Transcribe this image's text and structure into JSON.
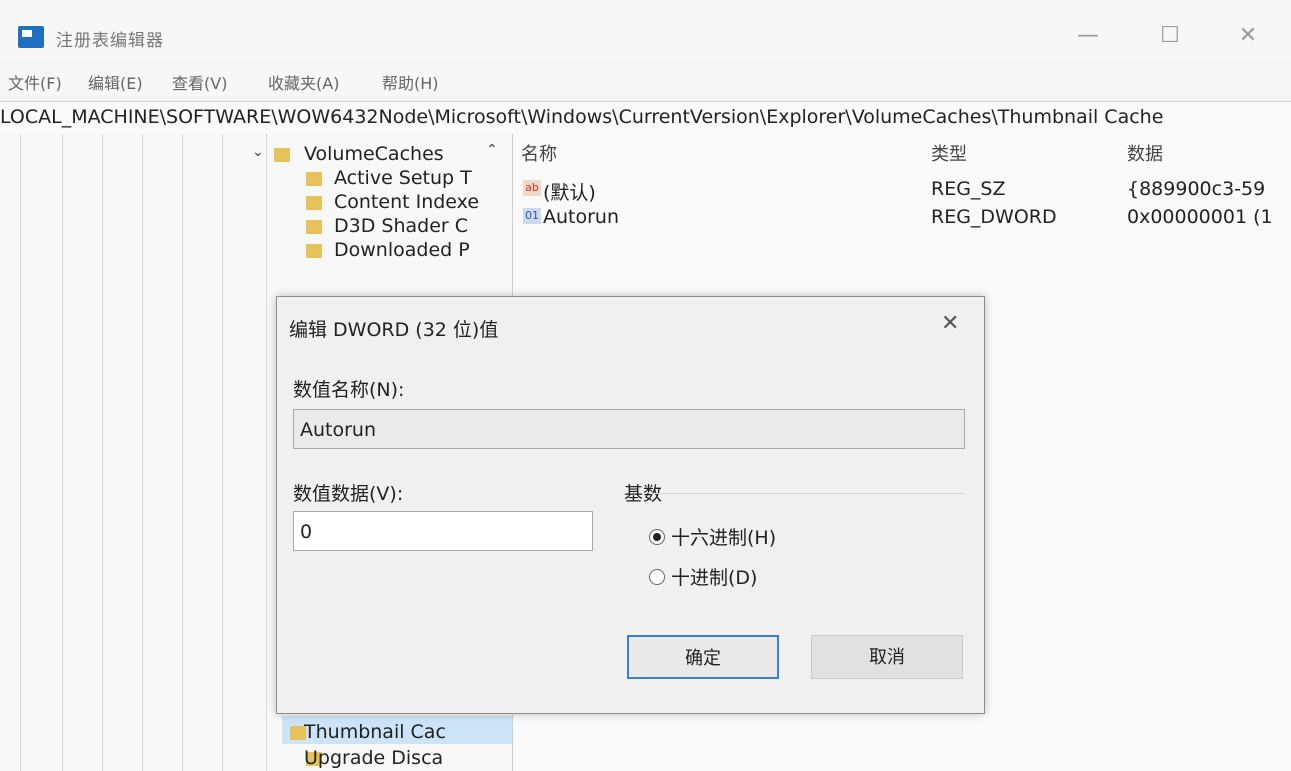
{
  "window": {
    "title": "注册表编辑器",
    "minimize": "—",
    "maximize": "☐",
    "close": "✕"
  },
  "menu": [
    "文件(F)",
    "编辑(E)",
    "查看(V)",
    "收藏夹(A)",
    "帮助(H)"
  ],
  "address": "LOCAL_MACHINE\\SOFTWARE\\WOW6432Node\\Microsoft\\Windows\\CurrentVersion\\Explorer\\VolumeCaches\\Thumbnail Cache",
  "tree": {
    "parent": "VolumeCaches",
    "items": [
      "Active Setup T",
      "Content Indexe",
      "D3D Shader C",
      "Downloaded P"
    ],
    "bottom_items": [
      "Thumbnail Cac",
      "Upgrade Disca"
    ]
  },
  "list": {
    "headers": [
      "名称",
      "类型",
      "数据"
    ],
    "rows": [
      {
        "name": "(默认)",
        "type": "REG_SZ",
        "data": "{889900c3-59"
      },
      {
        "name": "Autorun",
        "type": "REG_DWORD",
        "data": "0x00000001 (1"
      }
    ]
  },
  "dialog": {
    "title": "编辑 DWORD (32 位)值",
    "close": "✕",
    "name_label": "数值名称(N):",
    "name_value": "Autorun",
    "data_label": "数值数据(V):",
    "data_value": "0",
    "base_label": "基数",
    "radio_hex": "十六进制(H)",
    "radio_dec": "十进制(D)",
    "selected_base": "hex",
    "ok": "确定",
    "cancel": "取消"
  }
}
